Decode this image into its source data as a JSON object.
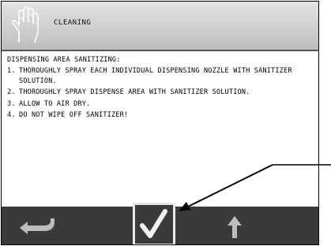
{
  "header": {
    "title": "CLEANING",
    "icon": "hand-icon"
  },
  "content": {
    "heading": "DISPENSING AREA SANITIZING:",
    "steps": [
      {
        "num": "1.",
        "text": "THOROUGHLY SPRAY EACH INDIVIDUAL DISPENSING NOZZLE WITH SANITIZER SOLUTION."
      },
      {
        "num": "2.",
        "text": "THOROUGHLY SPRAY DISPENSE AREA WITH SANITIZER SOLUTION."
      },
      {
        "num": "3.",
        "text": "ALLOW TO AIR DRY."
      },
      {
        "num": "4.",
        "text": "DO NOT WIPE OFF SANITIZER!"
      }
    ]
  },
  "footer": {
    "back": "back-arrow-icon",
    "confirm": "checkmark-icon",
    "up": "up-arrow-icon"
  },
  "colors": {
    "footer_bg": "#3a3a3a",
    "header_bg": "#d0d0d0",
    "icon_gray": "#bdbdbd"
  }
}
